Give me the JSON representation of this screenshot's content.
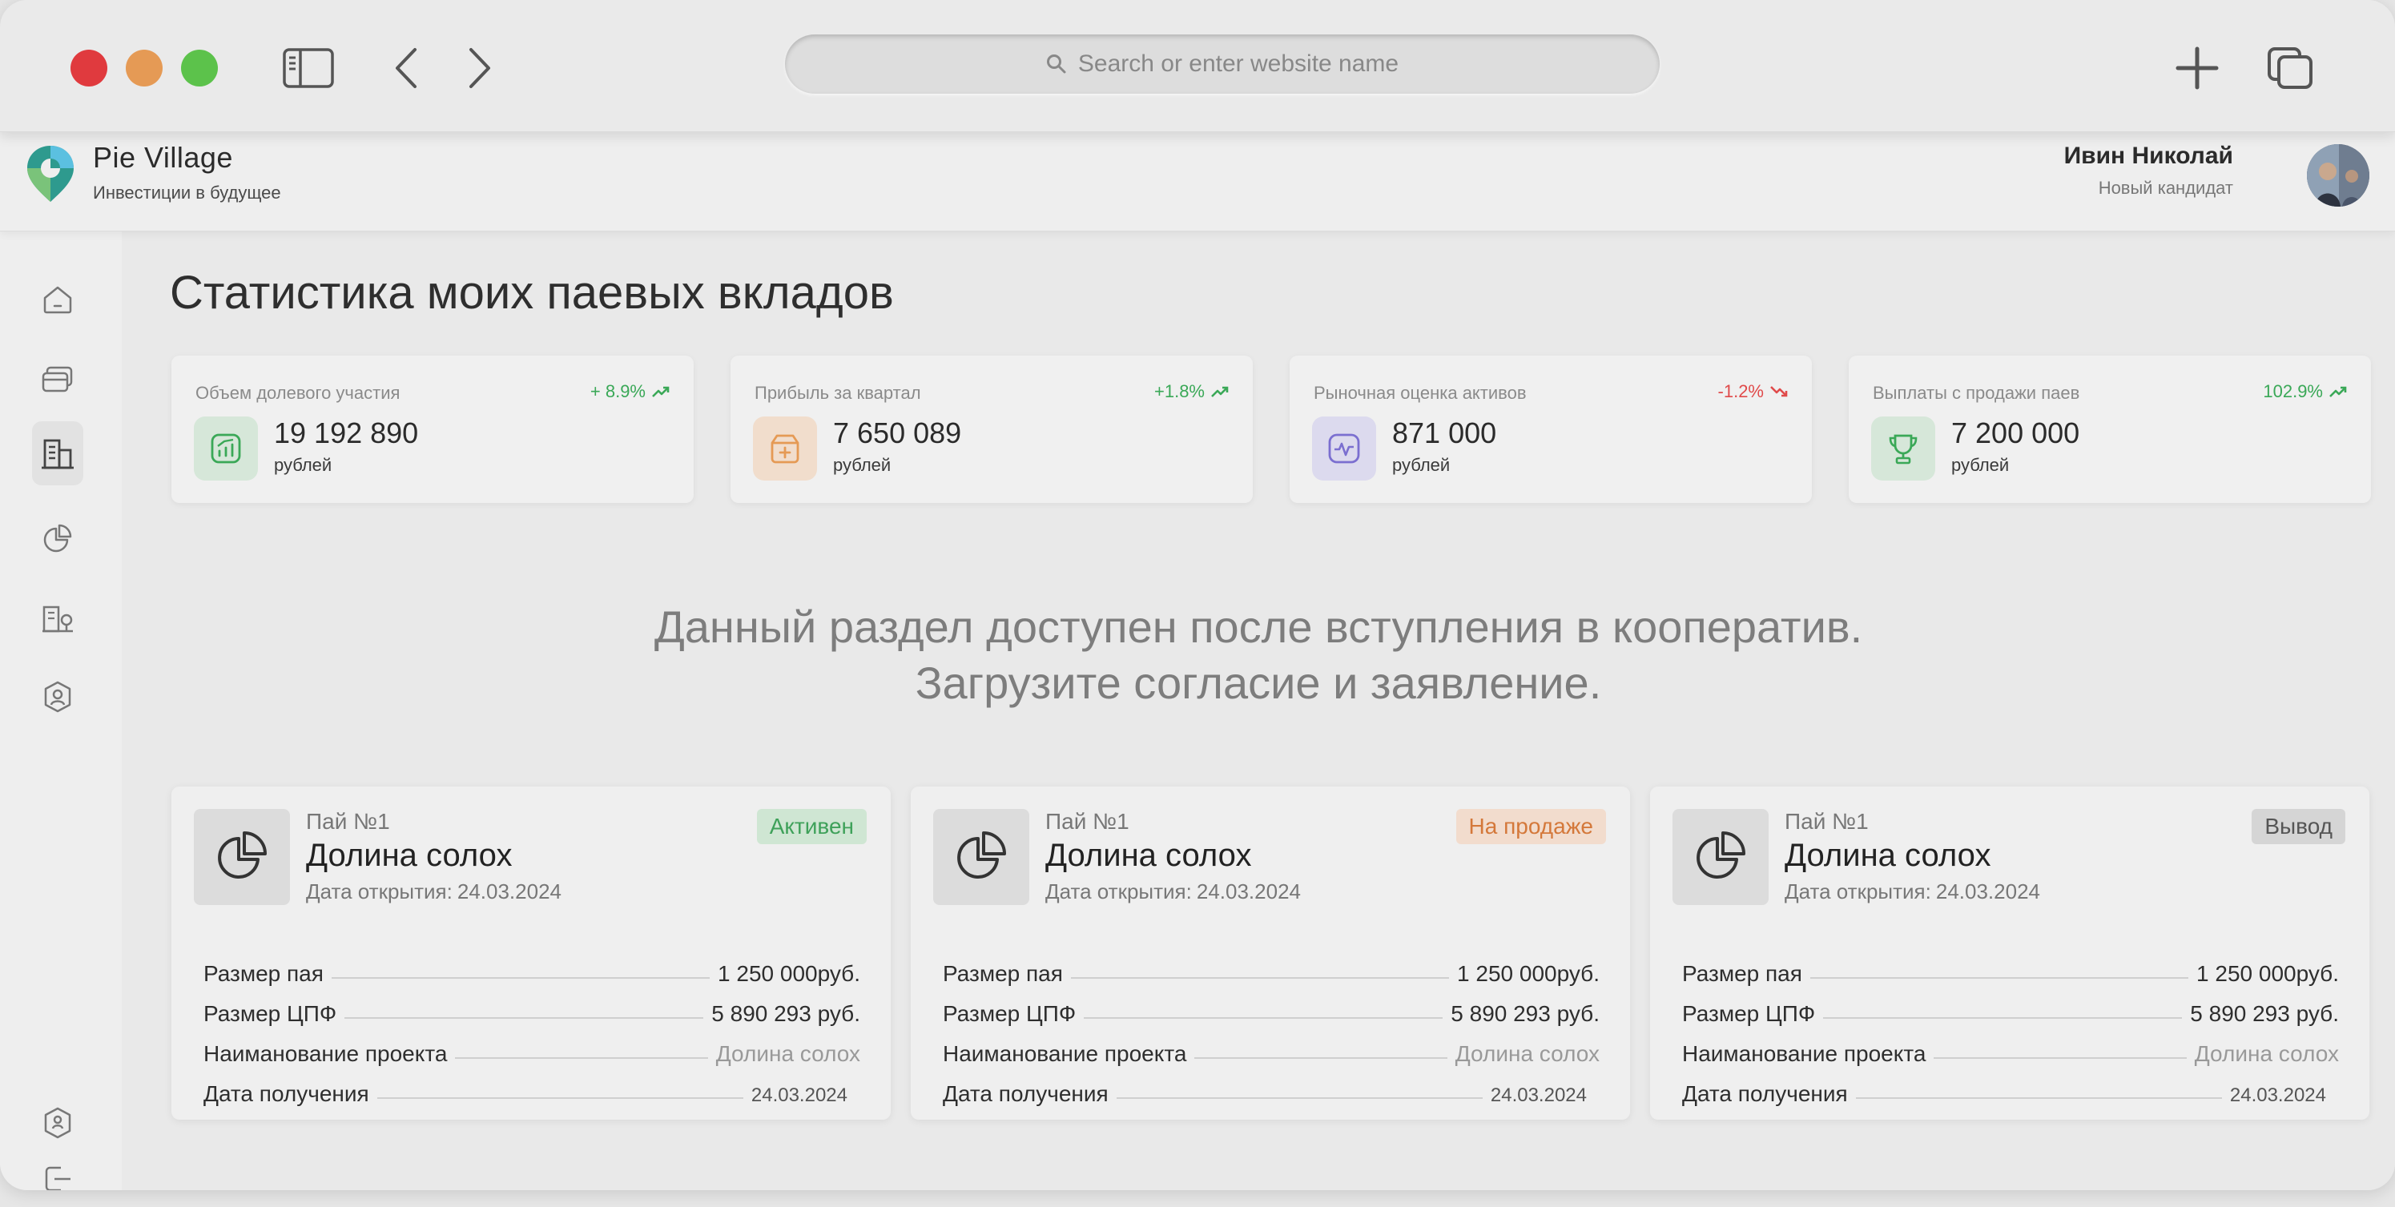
{
  "browser": {
    "url_placeholder": "Search or enter website name"
  },
  "app": {
    "name": "Pie Village",
    "tagline": "Инвестиции в будущее",
    "user_name": "Ивин Николай",
    "user_role": "Новый кандидат"
  },
  "page": {
    "title": "Статистика моих паевых вкладов",
    "notice_line1": "Данный раздел доступен после вступления в кооператив.",
    "notice_line2": "Загрузите согласие и заявление."
  },
  "stats": [
    {
      "label": "Объем долевого участия",
      "change": "+ 8.9%",
      "trend": "up",
      "value": "19 192 890",
      "unit": "рублей",
      "icon": "chart-growth-icon",
      "accent": "#3aa857"
    },
    {
      "label": "Прибыль за квартал",
      "change": "+1.8%",
      "trend": "up",
      "value": "7 650 089",
      "unit": "рублей",
      "icon": "box-plus-icon",
      "accent": "#e59a55"
    },
    {
      "label": "Рыночная оценка активов",
      "change": "-1.2%",
      "trend": "down",
      "value": "871 000",
      "unit": "рублей",
      "icon": "activity-icon",
      "accent": "#7b6fd0"
    },
    {
      "label": "Выплаты с продажи паев",
      "change": "102.9%",
      "trend": "up",
      "value": "7 200 000",
      "unit": "рублей",
      "icon": "trophy-icon",
      "accent": "#3aa857"
    }
  ],
  "pays": [
    {
      "number": "Пай №1",
      "name": "Долина солох",
      "date_label": "Дата открытия:",
      "date": "24.03.2024",
      "status": "Активен",
      "rows": [
        {
          "label": "Размер пая",
          "value": "1 250 000руб."
        },
        {
          "label": "Размер ЦПФ",
          "value": "5 890 293 руб."
        },
        {
          "label": "Наиманование проекта",
          "value": "Долина солох"
        },
        {
          "label": "Дата получения",
          "value": "24.03.2024"
        }
      ]
    },
    {
      "number": "Пай №1",
      "name": "Долина солох",
      "date_label": "Дата открытия:",
      "date": "24.03.2024",
      "status": "На продаже",
      "rows": [
        {
          "label": "Размер пая",
          "value": "1 250 000руб."
        },
        {
          "label": "Размер ЦПФ",
          "value": "5 890 293 руб."
        },
        {
          "label": "Наиманование проекта",
          "value": "Долина солох"
        },
        {
          "label": "Дата получения",
          "value": "24.03.2024"
        }
      ]
    },
    {
      "number": "Пай №1",
      "name": "Долина солох",
      "date_label": "Дата открытия:",
      "date": "24.03.2024",
      "status": "Вывод",
      "rows": [
        {
          "label": "Размер пая",
          "value": "1 250 000руб."
        },
        {
          "label": "Размер ЦПФ",
          "value": "5 890 293 руб."
        },
        {
          "label": "Наиманование проекта",
          "value": "Долина солох"
        },
        {
          "label": "Дата получения",
          "value": "24.03.2024"
        }
      ]
    }
  ],
  "colors": {
    "up": "#3aa857",
    "down": "#e04a4a"
  }
}
